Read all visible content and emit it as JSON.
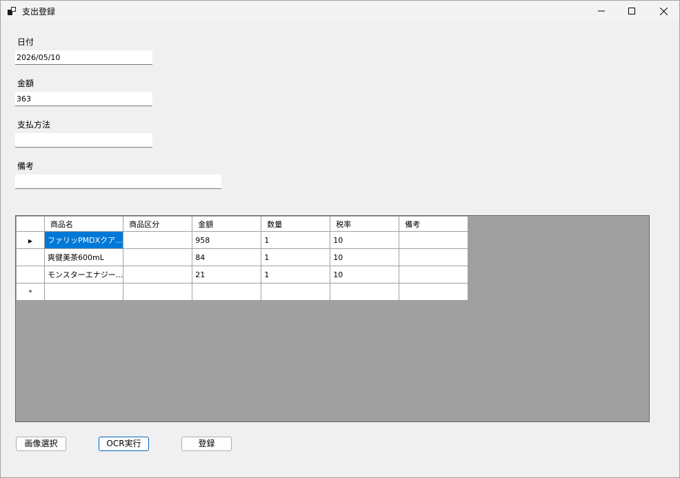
{
  "window": {
    "title": "支出登録",
    "minimize_glyph": "—",
    "maximize_glyph": "☐",
    "close_glyph": "✕"
  },
  "form": {
    "date_label": "日付",
    "date_value": "2026/05/10",
    "amount_label": "金額",
    "amount_value": "363",
    "payment_label": "支払方法",
    "payment_value": "",
    "note_label": "備考",
    "note_value": ""
  },
  "grid": {
    "columns": [
      "商品名",
      "商品区分",
      "金額",
      "数量",
      "税率",
      "備考"
    ],
    "rows": [
      [
        "ファリッPMDXクア...",
        "",
        "958",
        "1",
        "10",
        ""
      ],
      [
        "爽健美茶600mL",
        "",
        "84",
        "1",
        "10",
        ""
      ],
      [
        "モンスターエナジー...",
        "",
        "21",
        "1",
        "10",
        ""
      ]
    ],
    "current_row_glyph": "▶",
    "new_row_glyph": "*"
  },
  "buttons": {
    "select_image": "画像選択",
    "run_ocr": "OCR実行",
    "register": "登録"
  }
}
